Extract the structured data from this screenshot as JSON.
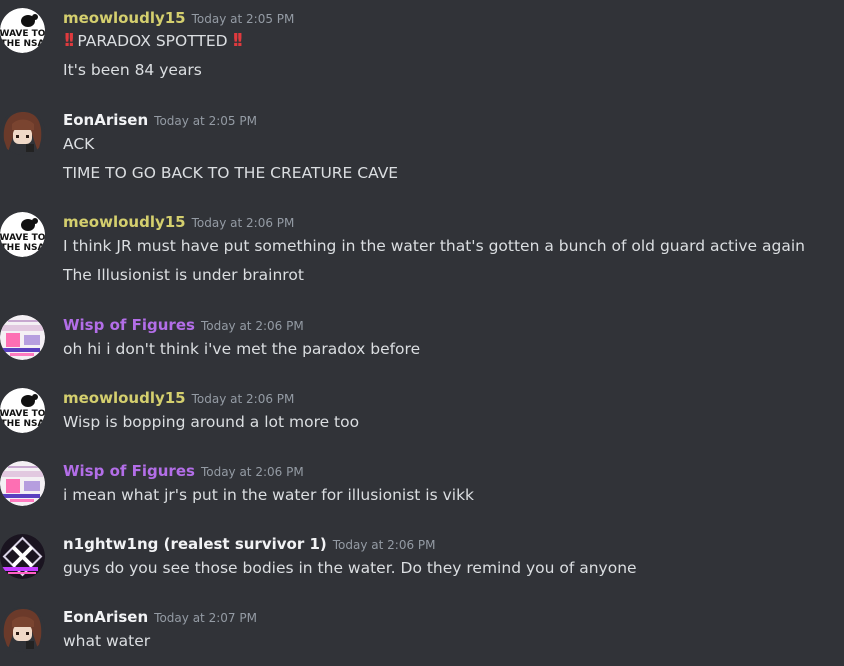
{
  "colors": {
    "background": "#313338",
    "text": "#dbdee1",
    "timestamp": "#949ba4",
    "meowloudly15": "#d4cf6e",
    "EonArisen": "#f2f3f5",
    "Wisp of Figures": "#b36ee8",
    "n1ghtw1ng": "#f2f3f5"
  },
  "messages": [
    {
      "author": "meowloudly15",
      "time": "Today at 2:05 PM",
      "avatar": "wave-to-the-nsa-avatar",
      "avatar_text": "WAVE TO THE NSA",
      "lines": [
        "PARADOX SPOTTED",
        "It's been 84 years"
      ]
    },
    {
      "author": "EonArisen",
      "time": "Today at 2:05 PM",
      "avatar": "brown-hair-avatar",
      "lines": [
        "ACK",
        "TIME TO GO BACK TO THE CREATURE CAVE"
      ]
    },
    {
      "author": "meowloudly15",
      "time": "Today at 2:06 PM",
      "avatar": "wave-to-the-nsa-avatar",
      "avatar_text": "WAVE TO THE NSA",
      "lines": [
        "I think JR must have put something in the water that's gotten a bunch of old guard active again",
        "The Illusionist is under brainrot"
      ]
    },
    {
      "author": "Wisp of Figures",
      "time": "Today at 2:06 PM",
      "avatar": "pink-glitch-avatar",
      "lines": [
        "oh hi i don't think i've met the paradox before"
      ]
    },
    {
      "author": "meowloudly15",
      "time": "Today at 2:06 PM",
      "avatar": "wave-to-the-nsa-avatar",
      "avatar_text": "WAVE TO THE NSA",
      "lines": [
        "Wisp is bopping around a lot more too"
      ]
    },
    {
      "author": "Wisp of Figures",
      "time": "Today at 2:06 PM",
      "avatar": "pink-glitch-avatar",
      "lines": [
        "i mean what jr's put in the water for illusionist is vikk"
      ]
    },
    {
      "author": "n1ghtw1ng (realest survivor 1)",
      "time": "Today at 2:06 PM",
      "avatar": "x-emblem-avatar",
      "lines": [
        "guys do you see those bodies in the water. Do they remind you of anyone"
      ]
    },
    {
      "author": "EonArisen",
      "time": "Today at 2:07 PM",
      "avatar": "brown-hair-avatar",
      "lines": [
        "what water"
      ]
    }
  ]
}
